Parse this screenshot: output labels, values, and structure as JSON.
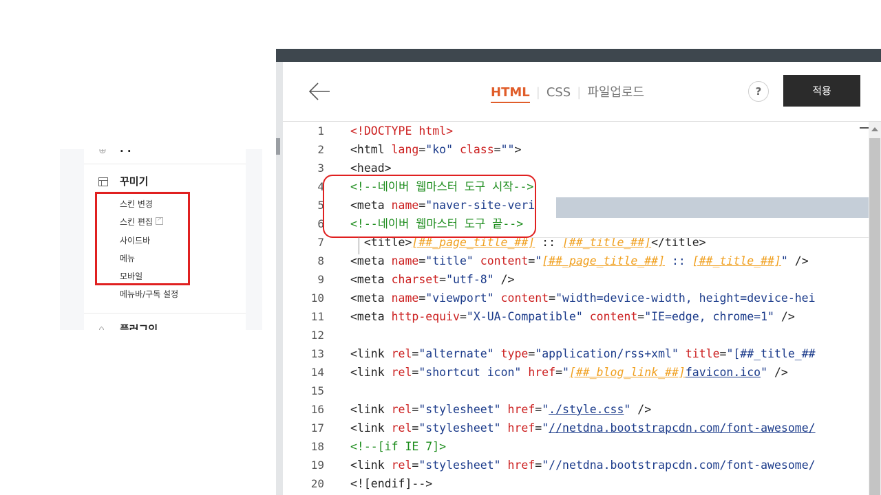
{
  "sidebar": {
    "section_title": "꾸미기",
    "cut_top_text": "· ·",
    "cut_bottom_text": "플러그인",
    "items": [
      {
        "label": "스킨 변경"
      },
      {
        "label": "스킨 편집"
      },
      {
        "label": "사이드바"
      },
      {
        "label": "메뉴"
      },
      {
        "label": "모바일"
      },
      {
        "label": "메뉴바/구독 설정"
      }
    ]
  },
  "editor": {
    "tabs": [
      {
        "label": "HTML",
        "active": true
      },
      {
        "label": "CSS",
        "active": false
      },
      {
        "label": "파일업로드",
        "active": false
      }
    ],
    "help_label": "?",
    "apply_label": "적용",
    "line_numbers": [
      "1",
      "2",
      "3",
      "4",
      "5",
      "6",
      "7",
      "8",
      "9",
      "10",
      "11",
      "12",
      "13",
      "14",
      "15",
      "16",
      "17",
      "18",
      "19",
      "20"
    ],
    "code_lines": [
      "<!DOCTYPE html>",
      "<html lang=\"ko\" class=\"\">",
      "<head>",
      "<!--네이버 웹마스터 도구 시작-->",
      "<meta name=\"naver-site-veri",
      "<!--네이버 웹마스터 도구 끝-->",
      "  <title>[##_page_title_##] :: [##_title_##]</title>",
      "<meta name=\"title\" content=\"[##_page_title_##] :: [##_title_##]\" />",
      "<meta charset=\"utf-8\" />",
      "<meta name=\"viewport\" content=\"width=device-width, height=device-hei",
      "<meta http-equiv=\"X-UA-Compatible\" content=\"IE=edge, chrome=1\" />",
      "",
      "<link rel=\"alternate\" type=\"application/rss+xml\" title=\"[##_title_##",
      "<link rel=\"shortcut icon\" href=\"[##_blog_link_##]favicon.ico\" />",
      "",
      "<link rel=\"stylesheet\" href=\"./style.css\" />",
      "<link rel=\"stylesheet\" href=\"//netdna.bootstrapcdn.com/font-awesome/",
      "<!--[if IE 7]>",
      "<link rel=\"stylesheet\" href=\"//netdna.bootstrapcdn.com/font-awesome/",
      "<![endif]-->"
    ]
  },
  "colors": {
    "accent": "#e05d2a",
    "annotation_red": "#e02020",
    "topbar": "#3e474e",
    "apply_button": "#2b2b2b"
  }
}
